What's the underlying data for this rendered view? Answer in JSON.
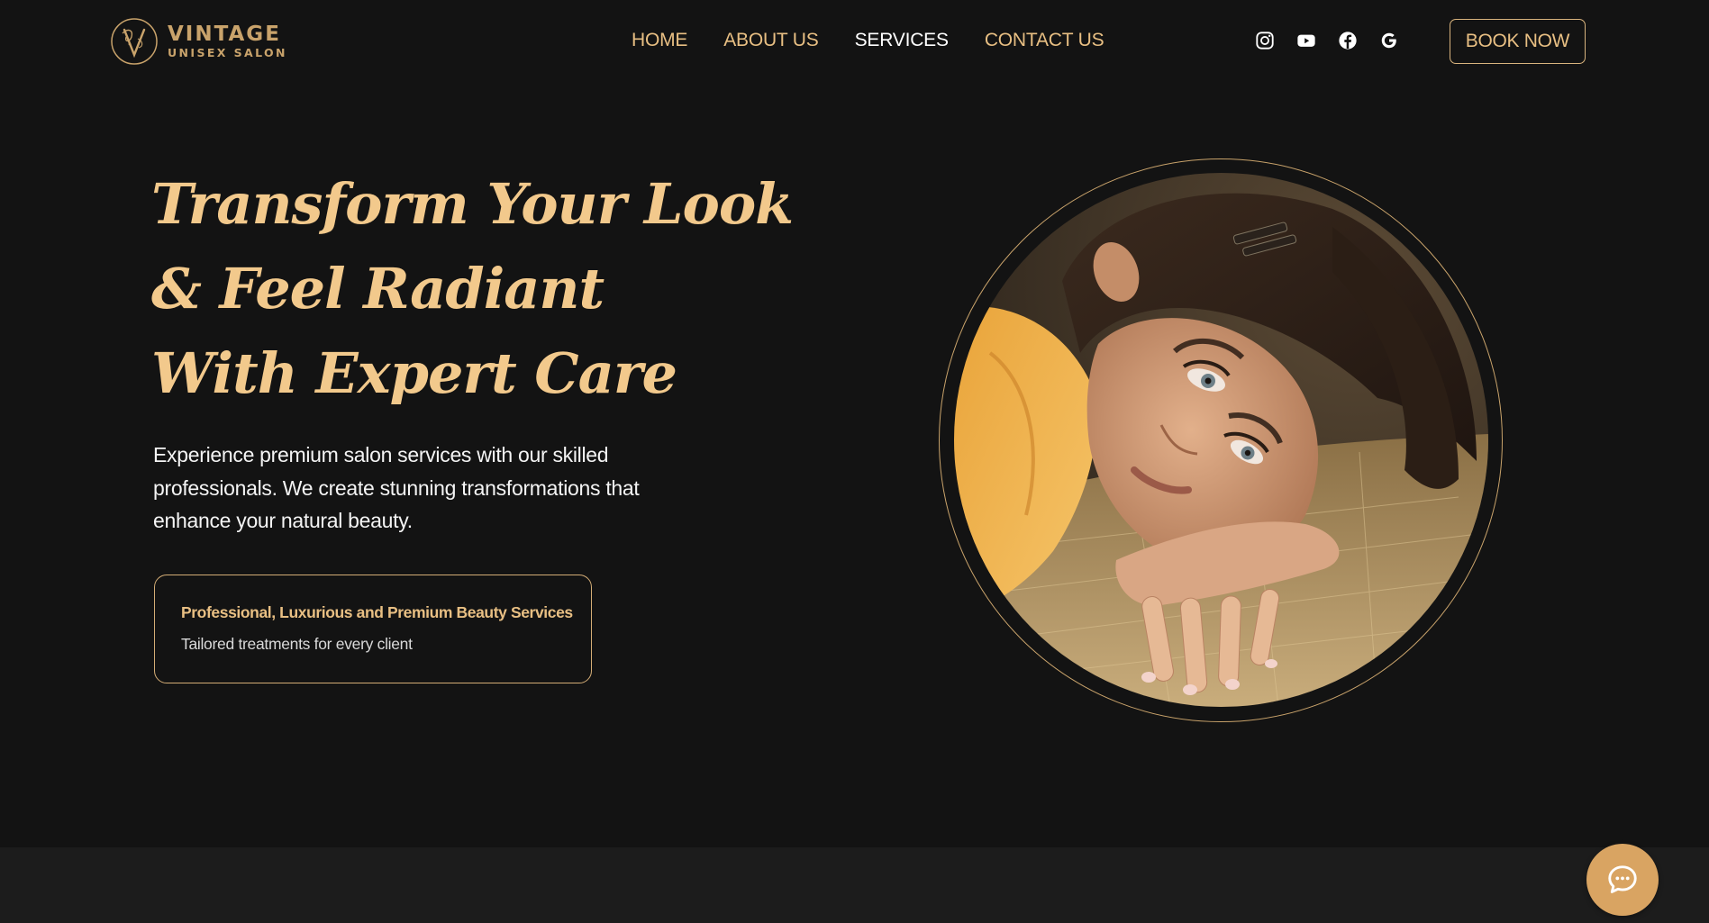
{
  "brand": {
    "name": "VINTAGE",
    "tagline": "UNISEX SALON",
    "logo_icon": "ornate-letter-v-logo-icon"
  },
  "nav": {
    "items": [
      {
        "label": "HOME",
        "active": false
      },
      {
        "label": "ABOUT US",
        "active": false
      },
      {
        "label": "SERVICES",
        "active": true
      },
      {
        "label": "CONTACT US",
        "active": false
      }
    ]
  },
  "socials": [
    {
      "name": "instagram-icon"
    },
    {
      "name": "youtube-icon"
    },
    {
      "name": "facebook-icon"
    },
    {
      "name": "google-icon"
    }
  ],
  "header": {
    "book_label": "BOOK NOW"
  },
  "hero": {
    "title_lines": [
      "Transform Your Look",
      "& Feel Radiant",
      "With Expert Care"
    ],
    "description": "Experience premium salon services with our skilled professionals. We create stunning transformations that enhance your natural beauty.",
    "feature_title": "Professional, Luxurious and Premium Beauty Services",
    "feature_subtitle": "Tailored treatments for every client",
    "image_icon": "woman-portrait-photo"
  },
  "chat": {
    "icon": "chat-bubble-icon"
  },
  "colors": {
    "background": "#131313",
    "accent_gold": "#e8bf83",
    "title_gold": "#f2c98c",
    "ring_gold": "#c9a36b",
    "chat_button": "#d9a462",
    "bottom_band": "#1c1c1c"
  }
}
